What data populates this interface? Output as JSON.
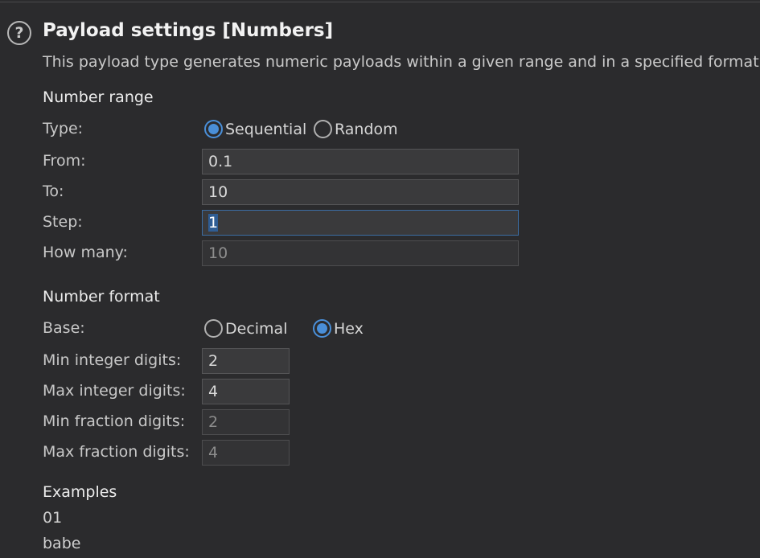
{
  "header": {
    "title": "Payload settings [Numbers]",
    "description": "This payload type generates numeric payloads within a given range and in a specified format.",
    "help_icon": "question-circle-icon",
    "help_glyph": "?"
  },
  "number_range": {
    "heading": "Number range",
    "type_label": "Type:",
    "type_options": [
      "Sequential",
      "Random"
    ],
    "type_selected": "Sequential",
    "from_label": "From:",
    "from_value": "0.1",
    "to_label": "To:",
    "to_value": "10",
    "step_label": "Step:",
    "step_value": "1",
    "how_many_label": "How many:",
    "how_many_value": "10"
  },
  "number_format": {
    "heading": "Number format",
    "base_label": "Base:",
    "base_options": [
      "Decimal",
      "Hex"
    ],
    "base_selected": "Hex",
    "min_int_label": "Min integer digits:",
    "min_int_value": "2",
    "max_int_label": "Max integer digits:",
    "max_int_value": "4",
    "min_frac_label": "Min fraction digits:",
    "min_frac_value": "2",
    "max_frac_label": "Max fraction digits:",
    "max_frac_value": "4"
  },
  "examples": {
    "heading": "Examples",
    "items": [
      "01",
      "babe"
    ]
  },
  "colors": {
    "background": "#2b2b2d",
    "accent": "#4a8fd8",
    "field_background": "#3a3a3c"
  }
}
